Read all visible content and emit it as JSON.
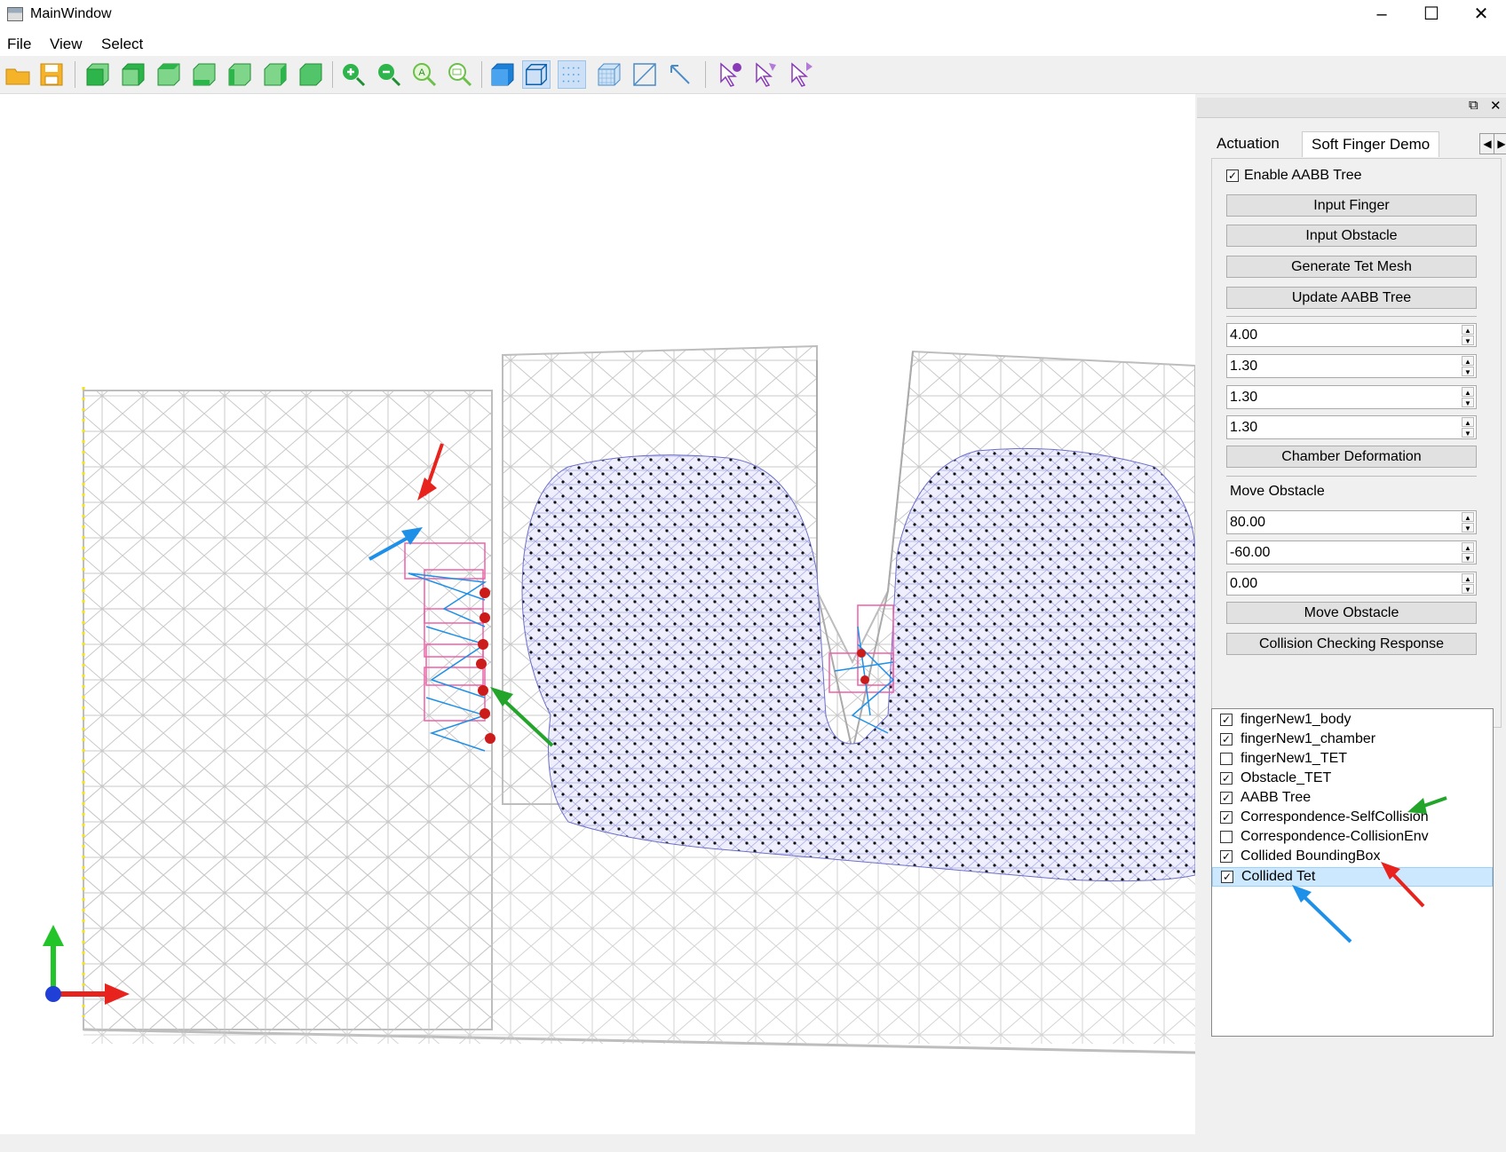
{
  "window": {
    "title": "MainWindow"
  },
  "menu": {
    "file": "File",
    "view": "View",
    "select": "Select"
  },
  "toolbar": {
    "icons": [
      "open-folder-icon",
      "save-icon",
      "view-front-icon",
      "view-back-icon",
      "view-top-icon",
      "view-bottom-icon",
      "view-left-icon",
      "view-right-icon",
      "view-iso-icon",
      "zoom-in-icon",
      "zoom-out-icon",
      "zoom-auto-icon",
      "zoom-window-icon",
      "shade-mode-icon",
      "wireframe-mode-icon",
      "point-mode-icon",
      "mesh-mode-icon",
      "edge-mode-icon",
      "arrow-mode-icon",
      "select-node-icon",
      "select-face-icon",
      "select-fix-icon"
    ]
  },
  "tabs": {
    "prev": "Actuation",
    "current": "Soft Finger Demo"
  },
  "panel": {
    "enable_aabb": "Enable AABB Tree",
    "input_finger": "Input Finger",
    "input_obstacle": "Input Obstacle",
    "generate_tet": "Generate Tet Mesh",
    "update_aabb": "Update AABB Tree",
    "spin1": "4.00",
    "spin2": "1.30",
    "spin3": "1.30",
    "spin4": "1.30",
    "chamber_deformation": "Chamber Deformation",
    "move_obstacle_label": "Move Obstacle",
    "move_x": "80.00",
    "move_y": "-60.00",
    "move_z": "0.00",
    "move_obstacle_btn": "Move Obstacle",
    "collision_btn": "Collision Checking Response"
  },
  "layers": [
    {
      "label": "fingerNew1_body",
      "checked": true
    },
    {
      "label": "fingerNew1_chamber",
      "checked": true
    },
    {
      "label": "fingerNew1_TET",
      "checked": false
    },
    {
      "label": "Obstacle_TET",
      "checked": true
    },
    {
      "label": "AABB Tree",
      "checked": true
    },
    {
      "label": "Correspondence-SelfCollision",
      "checked": true
    },
    {
      "label": "Correspondence-CollisionEnv",
      "checked": false
    },
    {
      "label": "Collided BoundingBox",
      "checked": true
    },
    {
      "label": "Collided Tet",
      "checked": true
    }
  ],
  "colors": {
    "accent_selected": "#cce8ff",
    "annotation_red": "#e8231e",
    "annotation_blue": "#1e90e8",
    "annotation_green": "#22a52a"
  }
}
